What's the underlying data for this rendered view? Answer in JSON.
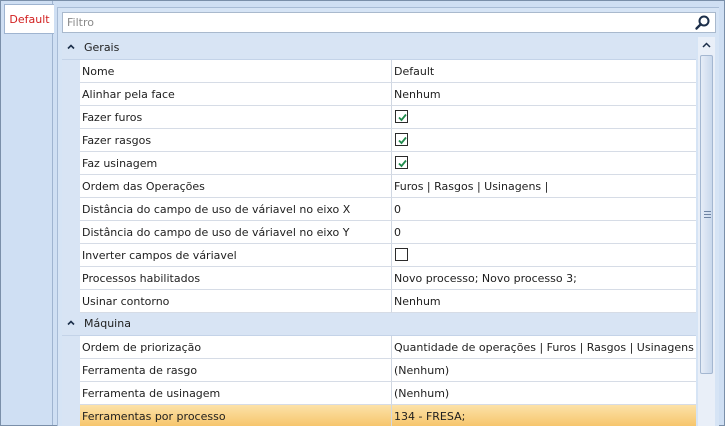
{
  "tab": {
    "label": "Default",
    "color": "#d21f1f"
  },
  "search": {
    "placeholder": "Filtro",
    "icon": "search-icon"
  },
  "categories": [
    {
      "label": "Gerais",
      "expanded": true
    },
    {
      "label": "Máquina",
      "expanded": true
    }
  ],
  "gerais": [
    {
      "name": "Nome",
      "value": "Default"
    },
    {
      "name": "Alinhar pela face",
      "value": "Nenhum"
    },
    {
      "name": "Fazer furos",
      "checked": true
    },
    {
      "name": "Fazer rasgos",
      "checked": true
    },
    {
      "name": "Faz usinagem",
      "checked": true
    },
    {
      "name": "Ordem das Operações",
      "value": "Furos | Rasgos | Usinagens |"
    },
    {
      "name": "Distância do campo de uso de váriavel no eixo X",
      "value": "0"
    },
    {
      "name": "Distância do campo de uso de váriavel no eixo Y",
      "value": "0"
    },
    {
      "name": "Inverter campos de váriavel",
      "checked": false
    },
    {
      "name": "Processos habilitados",
      "value": "Novo processo; Novo processo 3;"
    },
    {
      "name": "Usinar contorno",
      "value": "Nenhum"
    }
  ],
  "maquina": [
    {
      "name": "Ordem de priorização",
      "value": "Quantidade de operações | Furos | Rasgos | Usinagens |"
    },
    {
      "name": "Ferramenta de rasgo",
      "value": "(Nenhum)"
    },
    {
      "name": "Ferramenta de usinagem",
      "value": "(Nenhum)"
    },
    {
      "name": "Ferramentas por processo",
      "value": "134 - FRESA;",
      "selected": true
    }
  ],
  "colors": {
    "category_bg": "#d8e4f4",
    "selection": "#f6c46a",
    "checkmark": "#1f8a4c"
  }
}
